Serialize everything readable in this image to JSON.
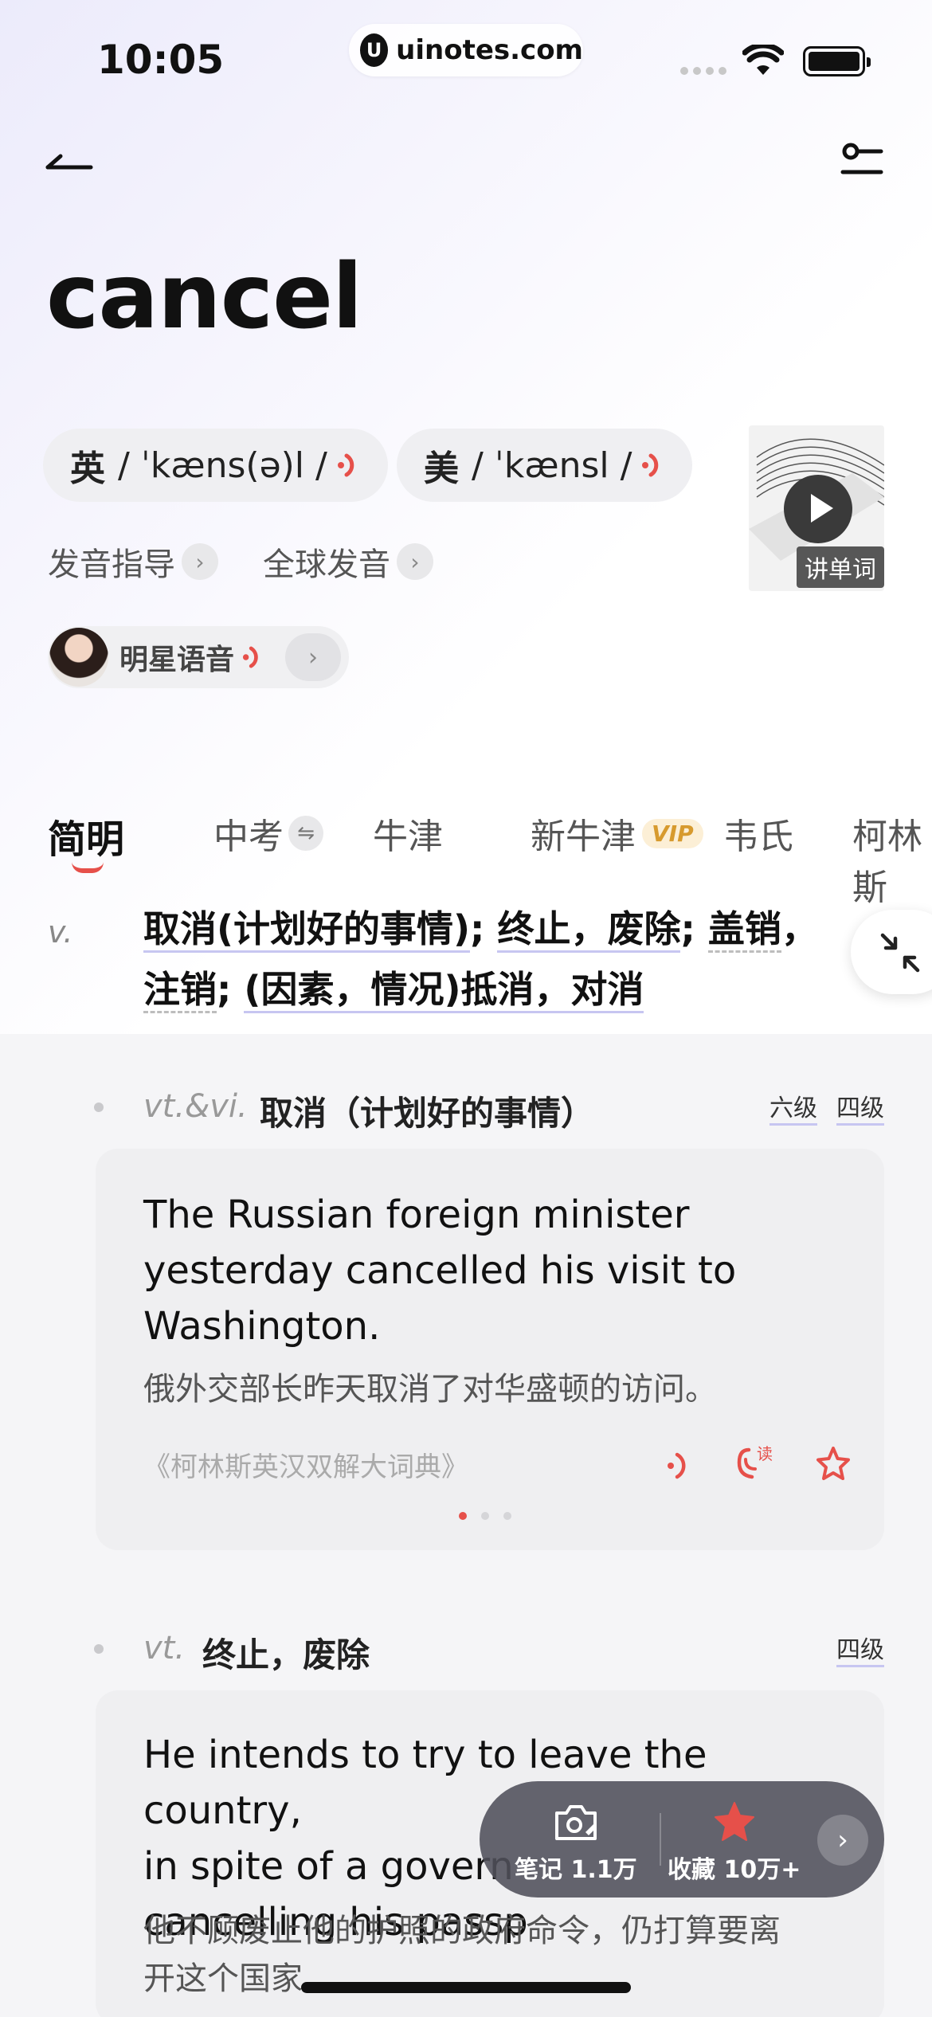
{
  "status_bar": {
    "time": "10:05",
    "url": "uinotes.com"
  },
  "word": "cancel",
  "pronunciations": [
    {
      "lang": "英",
      "ipa": "/ ˈkæns(ə)l /"
    },
    {
      "lang": "美",
      "ipa": "/ ˈkænsl /"
    }
  ],
  "video": {
    "caption": "讲单词"
  },
  "links": {
    "guide": "发音指导",
    "global": "全球发音",
    "star_voice": "明星语音"
  },
  "tabs": [
    "简明",
    "中考",
    "牛津",
    "新牛津",
    "韦氏",
    "柯林斯"
  ],
  "tab_vip": "VIP",
  "brief": {
    "pos": "v.",
    "parts": [
      "取消(计划好的事情)",
      "; ",
      "终止，废除",
      "; ",
      "盖销",
      "，",
      "注销",
      "; ",
      "(因素，情况)抵消，对消"
    ]
  },
  "senses": [
    {
      "pos": "vt.&vi.",
      "meaning": "取消（计划好的事情）",
      "tags": [
        "六级",
        "四级"
      ],
      "example_en": "The Russian foreign minister yesterday cancelled his visit to Washington.",
      "example_zh": "俄外交部长昨天取消了对华盛顿的访问。",
      "source": "《柯林斯英汉双解大词典》"
    },
    {
      "pos": "vt.",
      "meaning": "终止，废除",
      "tags": [
        "四级"
      ],
      "example_en": "He intends to try to leave the country, in spite of a government order cancelling his passport.",
      "example_en_visible": [
        "He intends to try to leave the country,",
        "in spite of a govern",
        "cancelling his passp"
      ],
      "example_zh": "他不顾废止他的护照的政府命令，仍打算要离开这个国家。",
      "example_zh_visible": [
        "他不顾废止他的护照的政府命令，仍打算要离",
        "开这个国家"
      ]
    }
  ],
  "toolbar": {
    "notes_label": "笔记 1.1万",
    "fav_label": "收藏 10万+"
  },
  "colors": {
    "accent": "#e6504a",
    "underline": "#c7c6f1",
    "toolbar_bg": "#50505a"
  }
}
